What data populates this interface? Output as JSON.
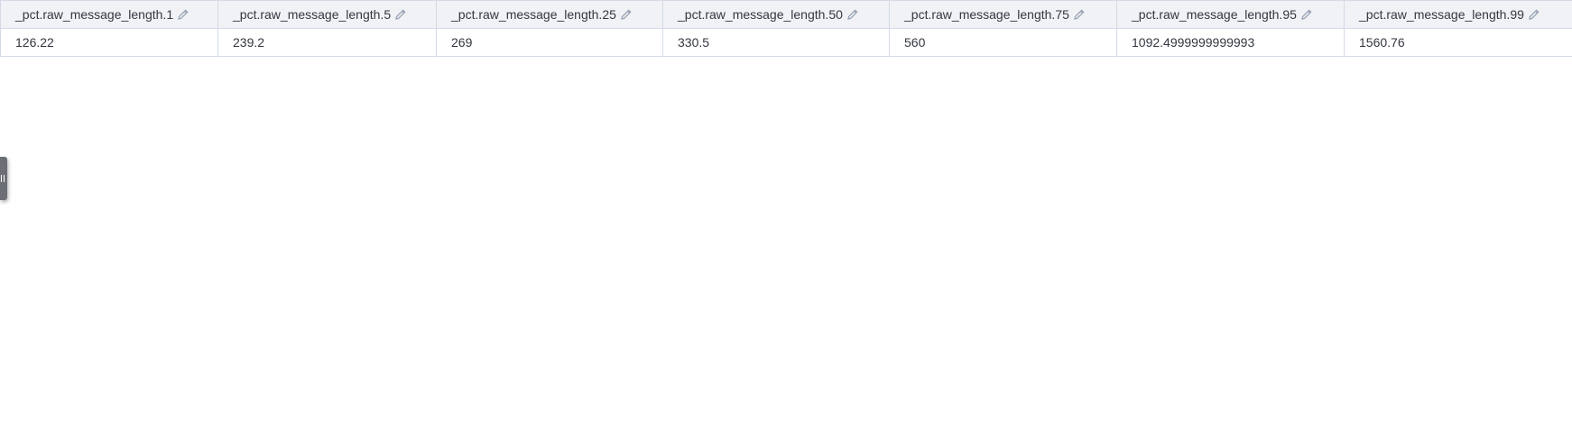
{
  "table": {
    "columns": [
      {
        "label": "_pct.raw_message_length.1",
        "icon": "pencil-icon"
      },
      {
        "label": "_pct.raw_message_length.5",
        "icon": "pencil-icon"
      },
      {
        "label": "_pct.raw_message_length.25",
        "icon": "pencil-icon"
      },
      {
        "label": "_pct.raw_message_length.50",
        "icon": "pencil-icon"
      },
      {
        "label": "_pct.raw_message_length.75",
        "icon": "pencil-icon"
      },
      {
        "label": "_pct.raw_message_length.95",
        "icon": "pencil-icon"
      },
      {
        "label": "_pct.raw_message_length.99",
        "icon": "pencil-icon"
      }
    ],
    "rows": [
      [
        "126.22",
        "239.2",
        "269",
        "330.5",
        "560",
        "1092.4999999999993",
        "1560.76"
      ]
    ]
  },
  "colors": {
    "header_bg": "#f0f2f5",
    "border": "#d3dae6",
    "text": "#343741",
    "icon": "#98a2b3",
    "handle": "#6b6e74"
  },
  "side_handle": {
    "icon": "drag-handle-icon"
  }
}
